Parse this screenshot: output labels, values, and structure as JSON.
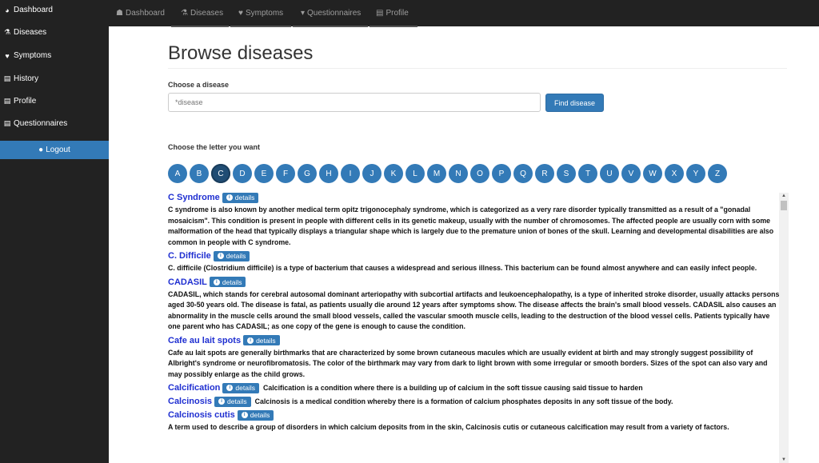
{
  "sidebar": {
    "items": [
      {
        "label": "Dashboard",
        "icon": "dashboard-icon"
      },
      {
        "label": "Diseases",
        "icon": "flask-icon"
      },
      {
        "label": "Symptoms",
        "icon": "heartbeat-icon"
      },
      {
        "label": "History",
        "icon": "list-icon"
      },
      {
        "label": "Profile",
        "icon": "id-card-icon"
      },
      {
        "label": "Questionnaires",
        "icon": "list-icon"
      }
    ],
    "logout_label": "Logout"
  },
  "topnav": {
    "items": [
      {
        "label": "Dashboard"
      },
      {
        "label": "Diseases"
      },
      {
        "label": "Symptoms"
      },
      {
        "label": "Questionnaires"
      },
      {
        "label": "Profile"
      }
    ]
  },
  "page": {
    "title": "Browse diseases",
    "choose_label": "Choose a disease",
    "search_placeholder": "*disease",
    "find_button": "Find disease",
    "letter_label": "Choose the letter you want",
    "active_letter": "C",
    "letters": [
      "A",
      "B",
      "C",
      "D",
      "E",
      "F",
      "G",
      "H",
      "I",
      "J",
      "K",
      "L",
      "M",
      "N",
      "O",
      "P",
      "Q",
      "R",
      "S",
      "T",
      "U",
      "V",
      "W",
      "X",
      "Y",
      "Z"
    ]
  },
  "diseases": [
    {
      "name": "C Syndrome",
      "details": "details",
      "description": "C syndrome is also known by another medical term opitz trigonocephaly syndrome, which is categorized as a very rare disorder typically transmitted as a result of a \"gonadal mosaicism\". This condition is present in people with different cells in its genetic makeup, usually with the number of chromosomes. The affected people are usually corn with some malformation of the head that typically displays a triangular shape which is largely due to the premature union of bones of the skull. Learning and developmental disabilities are also common in people with C syndrome.",
      "inline": false
    },
    {
      "name": "C. Difficile",
      "details": "details",
      "description": "C. difficile (Clostridium difficile) is a type of bacterium that causes a widespread and serious illness. This bacterium can be found almost anywhere and can easily infect people.",
      "inline": false
    },
    {
      "name": "CADASIL",
      "details": "details",
      "description": "CADASIL, which stands for cerebral autosomal dominant arteriopathy with subcortial artifacts and leukoencephalopathy, is a type of inherited stroke disorder, usually attacks persons aged 30-50 years old. The disease is fatal, as patients usually die around 12 years after symptoms show. The disease affects the brain's small blood vessels. CADASIL also causes an abnormality in the muscle cells around the small blood vessels, called the vascular smooth muscle cells, leading to the destruction of the blood vessel cells. Patients typically have one parent who has CADASIL; as one copy of the gene is enough to cause the condition.",
      "inline": false
    },
    {
      "name": "Cafe au lait spots",
      "details": "details",
      "description": "Cafe au lait spots are generally birthmarks that are characterized by some brown cutaneous macules which are usually evident at birth and may strongly suggest possibility of Albright's syndrome or neurofibromatosis. The color of the birthmark may vary from dark to light brown with some irregular or smooth borders. Sizes of the spot can also vary and may possibly enlarge as the child grows.",
      "inline": false
    },
    {
      "name": "Calcification",
      "details": "details",
      "description": "Calcification is a condition where there is a building up of calcium in the soft tissue causing said tissue to harden",
      "inline": true
    },
    {
      "name": "Calcinosis",
      "details": "details",
      "description": "Calcinosis is a medical condition whereby there is a formation of calcium phosphates deposits in any soft tissue of the body.",
      "inline": true
    },
    {
      "name": "Calcinosis cutis",
      "details": "details",
      "description": "A term used to describe a group of disorders in which calcium deposits from in the skin, Calcinosis cutis or cutaneous calcification may result from a variety of factors.",
      "inline": false
    }
  ]
}
